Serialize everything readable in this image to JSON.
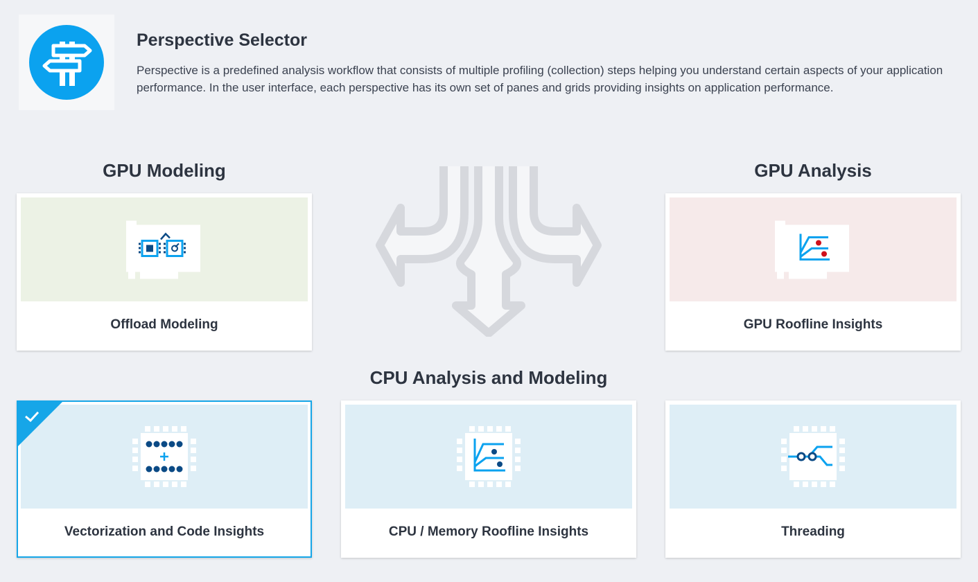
{
  "header": {
    "icon": "signpost-icon",
    "title": "Perspective Selector",
    "description": "Perspective is a predefined analysis workflow that consists of multiple profiling (collection) steps helping you understand certain aspects of your application performance. In the user interface, each perspective has its own set of panes and grids providing insights on application performance."
  },
  "sections": {
    "gpu_modeling": "GPU Modeling",
    "gpu_analysis": "GPU Analysis",
    "cpu": "CPU Analysis and Modeling"
  },
  "cards": {
    "offload_modeling": {
      "label": "Offload Modeling",
      "icon": "offload-modeling-icon",
      "bg": "#ecf2e5"
    },
    "gpu_roofline": {
      "label": "GPU Roofline Insights",
      "icon": "gpu-roofline-icon",
      "bg": "#f6eaea"
    },
    "vectorization": {
      "label": "Vectorization and Code Insights",
      "icon": "vectorization-chip-icon",
      "bg": "#deeef6",
      "selected": true
    },
    "cpu_roofline": {
      "label": "CPU / Memory Roofline Insights",
      "icon": "cpu-roofline-chip-icon",
      "bg": "#deeef6"
    },
    "threading": {
      "label": "Threading",
      "icon": "threading-chip-icon",
      "bg": "#deeef6"
    }
  },
  "colors": {
    "accent": "#0ba2ef",
    "selected_border": "#16a6e8",
    "dark_blue": "#0b4a85",
    "red_dot": "#d0101b"
  }
}
